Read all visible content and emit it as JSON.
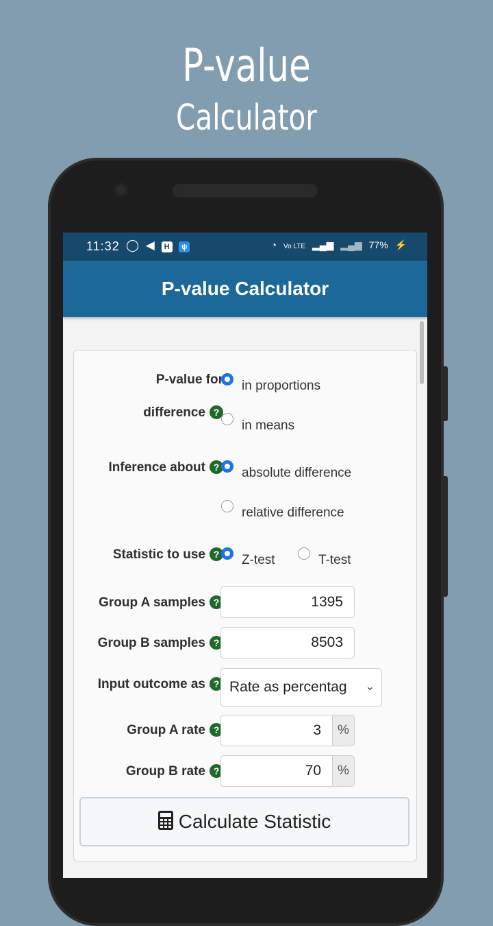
{
  "promo": {
    "title_line1": "P-value",
    "title_line2": "Calculator"
  },
  "status_bar": {
    "time": "11:32",
    "left_icons": [
      "whatsapp-icon",
      "telegram-icon",
      "h-badge-icon",
      "usb-icon"
    ],
    "right_text": {
      "volte": "Vo LTE",
      "battery": "77%"
    }
  },
  "app_bar": {
    "title": "P-value Calculator"
  },
  "form": {
    "pvalue_for": {
      "label_line1": "P-value for",
      "label_line2": "difference",
      "options": [
        "in proportions",
        "in means"
      ],
      "selected": "in proportions"
    },
    "inference": {
      "label": "Inference about",
      "options": [
        "absolute difference",
        "relative difference"
      ],
      "selected": "absolute difference"
    },
    "statistic": {
      "label": "Statistic to use",
      "options": [
        "Z-test",
        "T-test"
      ],
      "selected": "Z-test"
    },
    "group_a_samples": {
      "label": "Group A samples",
      "value": "1395"
    },
    "group_b_samples": {
      "label": "Group B samples",
      "value": "8503"
    },
    "input_outcome": {
      "label": "Input outcome as",
      "selected": "Rate as percentag"
    },
    "group_a_rate": {
      "label": "Group A rate",
      "value": "3",
      "unit": "%"
    },
    "group_b_rate": {
      "label": "Group B rate",
      "value": "70",
      "unit": "%"
    },
    "help_glyph": "?",
    "calculate_button": "Calculate Statistic"
  },
  "colors": {
    "background": "#819daf",
    "status_bar": "#17496c",
    "app_bar": "#1b6899",
    "radio_checked": "#1a73e8",
    "help_icon": "#1e6a2a"
  }
}
